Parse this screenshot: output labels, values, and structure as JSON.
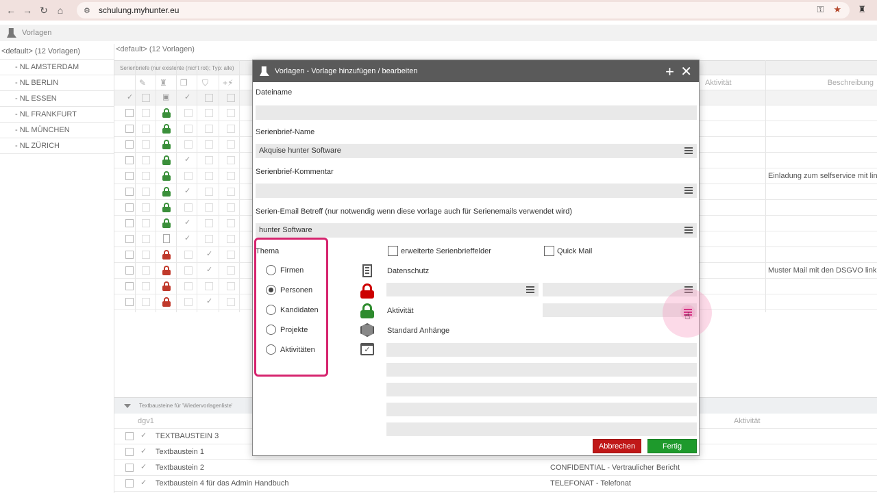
{
  "browser": {
    "url": "schulung.myhunter.eu"
  },
  "app": {
    "header_title": "Vorlagen",
    "crumb": "<default> (12 Vorlagen)"
  },
  "tree": {
    "root": "<default> (12 Vorlagen)",
    "items": [
      "- NL AMSTERDAM",
      "- NL BERLIN",
      "- NL ESSEN",
      "- NL FRANKFURT",
      "- NL MÜNCHEN",
      "- NL ZÜRICH"
    ]
  },
  "grid": {
    "bar_label": "Serienbriefe (nur existente (nicht rot); Typ: alle)",
    "col_aktivitat": "Aktivität",
    "col_beschreibung": "Beschreibung",
    "row_descriptions": [
      "",
      "",
      "",
      "",
      "Einladung zum selfservice mit link",
      "",
      "",
      "",
      "",
      "",
      "Muster Mail mit den DSGVO link",
      "",
      ""
    ]
  },
  "bottom": {
    "bar_label": "Textbausteine für 'Wiedervorlagenliste'",
    "head_col1": "dgv1",
    "head_col2": "Aktivität",
    "rows": [
      {
        "name": "TEXTBAUSTEIN 3",
        "info": ""
      },
      {
        "name": "Textbaustein 1",
        "info": ""
      },
      {
        "name": "Textbaustein 2",
        "info": "CONFIDENTIAL - Vertraulicher Bericht"
      },
      {
        "name": "Textbaustein 4 für das Admin Handbuch",
        "info": "TELEFONAT - Telefonat"
      }
    ]
  },
  "modal": {
    "title": "Vorlagen - Vorlage hinzufügen / bearbeiten",
    "dateiname_label": "Dateiname",
    "dateiname_value": "",
    "serienbrief_name_label": "Serienbrief-Name",
    "serienbrief_name_value": "Akquise hunter Software",
    "kommentar_label": "Serienbrief-Kommentar",
    "kommentar_value": "",
    "betreff_label": "Serien-Email Betreff (nur notwendig wenn diese vorlage auch für Serienemails verwendet wird)",
    "betreff_value": "hunter Software",
    "thema_label": "Thema",
    "thema_options": [
      "Firmen",
      "Personen",
      "Kandidaten",
      "Projekte",
      "Aktivitäten"
    ],
    "thema_selected": "Personen",
    "erweiterte_label": "erweiterte Serienbrieffelder",
    "quickmail_label": "Quick Mail",
    "datenschutz_label": "Datenschutz",
    "aktivitat_label": "Aktivität",
    "anhaenge_label": "Standard Anhänge",
    "cancel_label": "Abbrechen",
    "done_label": "Fertig"
  },
  "colors": {
    "highlight": "#d6246e",
    "cancel": "#c01818",
    "done": "#1e9a2c",
    "titlebar": "#5a5a5a"
  }
}
